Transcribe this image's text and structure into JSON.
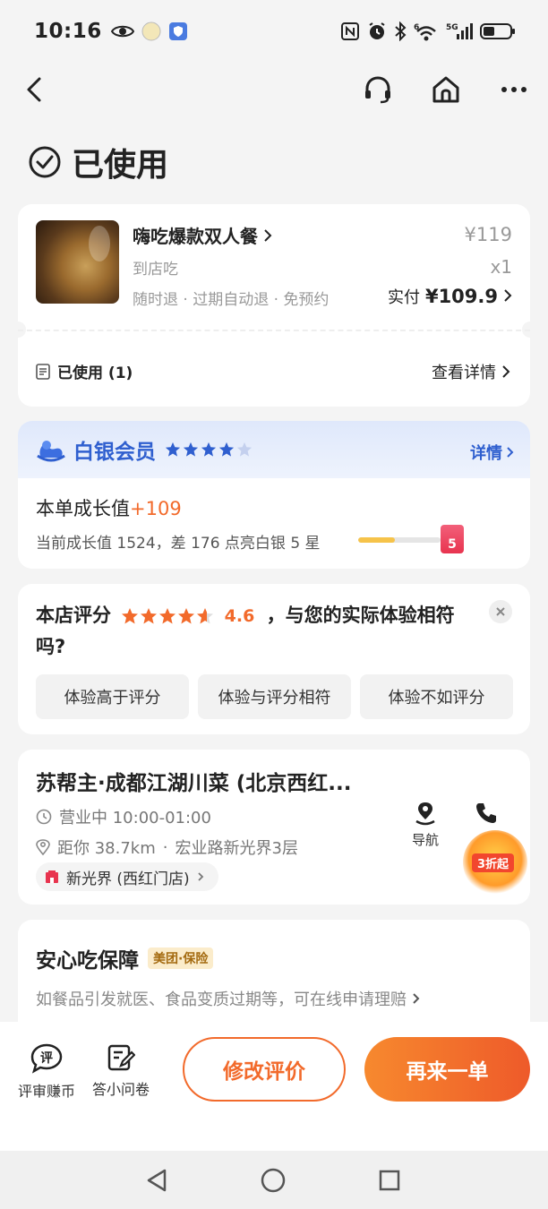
{
  "status_bar": {
    "time": "10:16",
    "left_icons": [
      "eye-icon",
      "moon-icon",
      "app-shield-icon"
    ],
    "right_icons": [
      "nfc-icon",
      "alarm-icon",
      "bluetooth-icon",
      "wifi-icon",
      "cellular-5g-icon",
      "battery-icon"
    ],
    "network": "5G",
    "wifi_badge": "6"
  },
  "nav": {
    "icons": [
      "back-icon",
      "headset-icon",
      "home-icon",
      "more-icon"
    ]
  },
  "order_status": {
    "title": "已使用"
  },
  "order": {
    "name": "嗨吃爆款双人餐",
    "type": "到店吃",
    "tags": "随时退 · 过期自动退 · 免预约",
    "price": "¥119",
    "qty": "x1",
    "paid_label": "实付",
    "paid_amount": "¥109.9",
    "used_label": "已使用 (1)",
    "detail_link": "查看详情"
  },
  "member": {
    "title": "白银会员",
    "stars_filled": 4,
    "stars_total": 5,
    "detail_label": "详情",
    "growth_label": "本单成长值",
    "growth_value": "+109",
    "growth_status": "当前成长值 1524，差 176 点亮白银 5 星",
    "progress": 0.45,
    "badge_number": "5"
  },
  "rating": {
    "label": "本店评分",
    "score": "4.6",
    "stars_value": 4.6,
    "question": "，与您的实际体验相符吗?",
    "options": [
      "体验高于评分",
      "体验与评分相符",
      "体验不如评分"
    ]
  },
  "shop": {
    "name": "苏帮主·成都江湖川菜 (北京西红...",
    "hours": "营业中 10:00-01:00",
    "distance": "距你 38.7km",
    "address": "宏业路新光界3层",
    "mall": "新光界 (西红门店)",
    "nav_label": "导航",
    "promo_label": "3折起"
  },
  "assurance": {
    "title": "安心吃保障",
    "badge": "美团·保险",
    "desc": "如餐品引发就医、食品变质过期等，可在线申请理赔"
  },
  "bottom_bar": {
    "review_earn": "评审赚币",
    "review_icon_char": "评",
    "survey": "答小问卷",
    "edit_review": "修改评价",
    "reorder": "再来一单"
  },
  "colors": {
    "accent_orange": "#f26a2b",
    "member_blue": "#2f5fcf",
    "star_orange": "#f26a2b"
  }
}
